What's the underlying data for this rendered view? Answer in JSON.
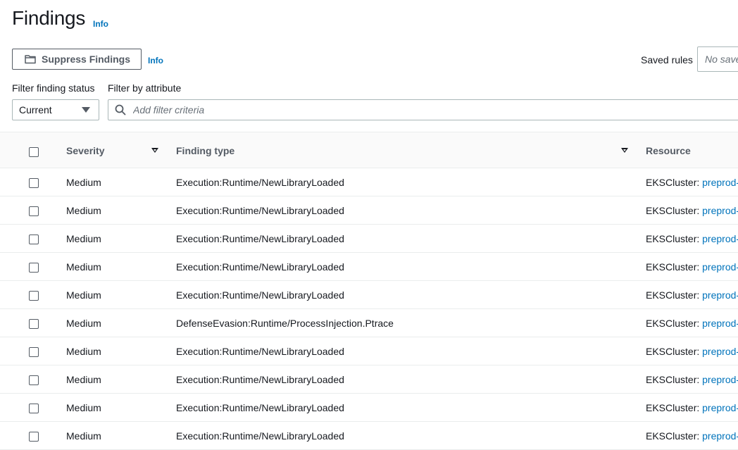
{
  "page": {
    "title": "Findings",
    "info_label": "Info"
  },
  "toolbar": {
    "suppress_label": "Suppress Findings",
    "info_label": "Info",
    "saved_rules_label": "Saved rules",
    "saved_rules_placeholder": "No saved rules"
  },
  "filters": {
    "status_label": "Filter finding status",
    "status_value": "Current",
    "attribute_label": "Filter by attribute",
    "search_placeholder": "Add filter criteria"
  },
  "table": {
    "columns": {
      "severity": "Severity",
      "finding_type": "Finding type",
      "resource": "Resource"
    },
    "rows": [
      {
        "severity": "Medium",
        "finding_type": "Execution:Runtime/NewLibraryLoaded",
        "resource_prefix": "EKSCluster: ",
        "resource_link": "preprod-"
      },
      {
        "severity": "Medium",
        "finding_type": "Execution:Runtime/NewLibraryLoaded",
        "resource_prefix": "EKSCluster: ",
        "resource_link": "preprod-"
      },
      {
        "severity": "Medium",
        "finding_type": "Execution:Runtime/NewLibraryLoaded",
        "resource_prefix": "EKSCluster: ",
        "resource_link": "preprod-"
      },
      {
        "severity": "Medium",
        "finding_type": "Execution:Runtime/NewLibraryLoaded",
        "resource_prefix": "EKSCluster: ",
        "resource_link": "preprod-"
      },
      {
        "severity": "Medium",
        "finding_type": "Execution:Runtime/NewLibraryLoaded",
        "resource_prefix": "EKSCluster: ",
        "resource_link": "preprod-"
      },
      {
        "severity": "Medium",
        "finding_type": "DefenseEvasion:Runtime/ProcessInjection.Ptrace",
        "resource_prefix": "EKSCluster: ",
        "resource_link": "preprod-"
      },
      {
        "severity": "Medium",
        "finding_type": "Execution:Runtime/NewLibraryLoaded",
        "resource_prefix": "EKSCluster: ",
        "resource_link": "preprod-"
      },
      {
        "severity": "Medium",
        "finding_type": "Execution:Runtime/NewLibraryLoaded",
        "resource_prefix": "EKSCluster: ",
        "resource_link": "preprod-"
      },
      {
        "severity": "Medium",
        "finding_type": "Execution:Runtime/NewLibraryLoaded",
        "resource_prefix": "EKSCluster: ",
        "resource_link": "preprod-"
      },
      {
        "severity": "Medium",
        "finding_type": "Execution:Runtime/NewLibraryLoaded",
        "resource_prefix": "EKSCluster: ",
        "resource_link": "preprod-"
      }
    ]
  },
  "icons": {
    "suppress": "folder-suppress-icon",
    "search": "search-icon",
    "dropdown": "caret-down-icon",
    "sort": "sort-descending-icon"
  },
  "colors": {
    "link": "#0073bb",
    "text": "#16191f",
    "muted": "#545b64",
    "border": "#aab7b8"
  }
}
